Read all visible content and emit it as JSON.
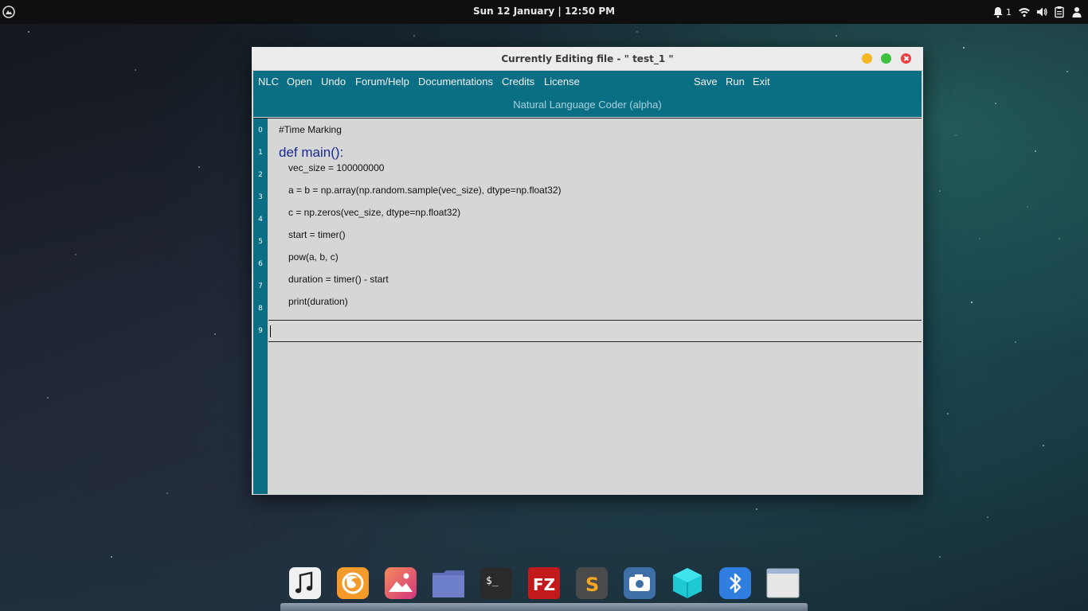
{
  "topbar": {
    "clock": "Sun 12 January | 12:50 PM",
    "notification_count": "1",
    "icons": [
      "distro-logo-icon",
      "notification-bell-icon",
      "wifi-icon",
      "volume-icon",
      "clipboard-icon",
      "user-icon"
    ]
  },
  "window": {
    "title": "Currently Editing file - \" test_1 \"",
    "controls": [
      "minimize-button",
      "maximize-button",
      "close-button"
    ],
    "colors": {
      "accent": "#0a6f85",
      "minimize": "#f5b722",
      "maximize": "#3dc140",
      "close": "#ee3f3f"
    }
  },
  "menu": {
    "left": [
      {
        "label": "NLC"
      },
      {
        "label": "Open"
      },
      {
        "label": "Undo"
      },
      {
        "label": "Forum/Help"
      },
      {
        "label": "Documentations"
      },
      {
        "label": "Credits"
      },
      {
        "label": "License"
      }
    ],
    "right": [
      {
        "label": "Save"
      },
      {
        "label": "Run"
      },
      {
        "label": "Exit"
      }
    ],
    "subtitle": "Natural Language Coder (alpha)"
  },
  "editor": {
    "line_numbers": [
      "0",
      "1",
      "2",
      "3",
      "4",
      "5",
      "6",
      "7",
      "8",
      "9"
    ],
    "lines": [
      "#Time Marking",
      "def main():",
      "vec_size = 100000000",
      "a = b = np.array(np.random.sample(vec_size), dtype=np.float32)",
      "c = np.zeros(vec_size, dtype=np.float32)",
      "start = timer()",
      "pow(a, b, c)",
      "duration = timer() - start",
      "print(duration)",
      ""
    ]
  },
  "dock": {
    "apps": [
      "music-app-icon",
      "firefox-icon",
      "photos-icon",
      "files-folder-icon",
      "terminal-icon",
      "filezilla-icon",
      "sublime-text-icon",
      "screenshot-camera-icon",
      "3d-cube-app-icon",
      "bluetooth-icon",
      "window-app-icon"
    ],
    "terminal_label": "$_",
    "filezilla_label": "FZ",
    "sublime_label": "S"
  }
}
